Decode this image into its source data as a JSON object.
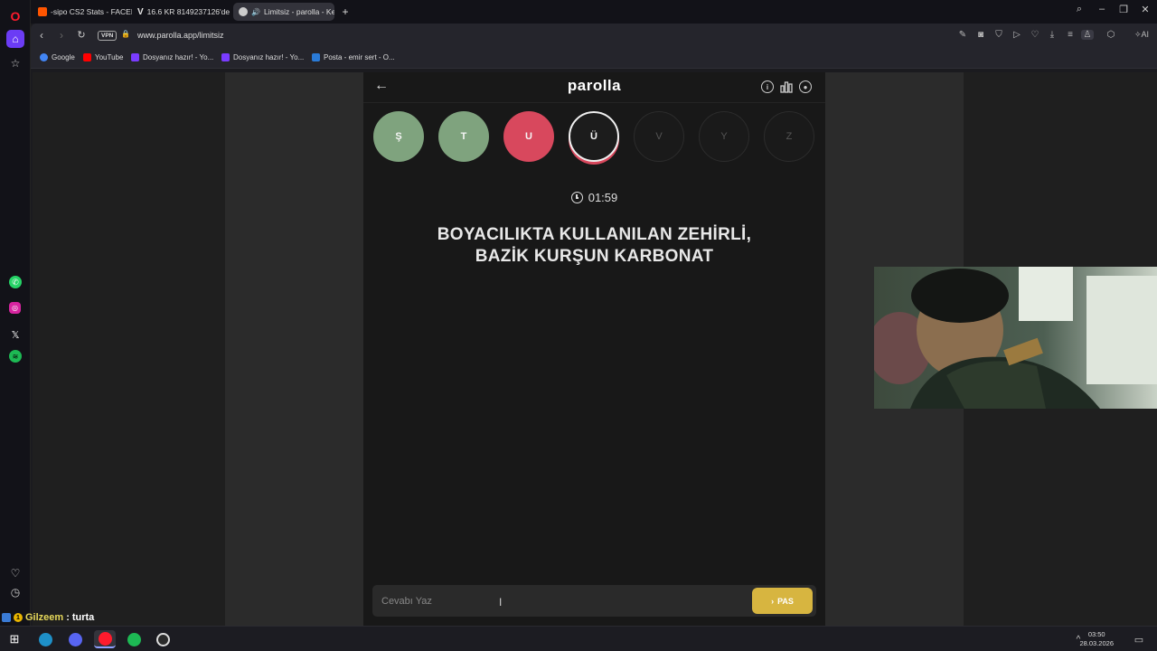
{
  "browser": {
    "tabs": [
      {
        "title": "-sipo CS2 Stats - FACEIT.c",
        "active": false,
        "color": "#ff5500"
      },
      {
        "title": "16.6 KR 8149237126'de Fı",
        "active": false,
        "color": "#e8e8e8"
      },
      {
        "title": "Limitsiz - parolla - Ke",
        "active": true,
        "color": "#cccccc"
      }
    ],
    "vpn_label": "VPN",
    "url": "www.parolla.app/limitsiz",
    "ai_label": "AI",
    "bookmarks": [
      {
        "label": "Google",
        "color": "#4285f4"
      },
      {
        "label": "YouTube",
        "color": "#ff0000"
      },
      {
        "label": "Dosyanız hazır! - Yo...",
        "color": "#7a3cff"
      },
      {
        "label": "Dosyanız hazır! - Yo...",
        "color": "#7a3cff"
      },
      {
        "label": "Posta - emir sert - O...",
        "color": "#2a7bd8"
      }
    ]
  },
  "game": {
    "brand": "parolla",
    "letters": [
      {
        "char": "Ş",
        "state": "correct"
      },
      {
        "char": "T",
        "state": "correct"
      },
      {
        "char": "U",
        "state": "wrong"
      },
      {
        "char": "Ü",
        "state": "current"
      },
      {
        "char": "V",
        "state": "pending"
      },
      {
        "char": "Y",
        "state": "pending"
      },
      {
        "char": "Z",
        "state": "pending"
      }
    ],
    "timer": "01:59",
    "question_line1": "BOYACILIKTA KULLANILAN ZEHİRLİ,",
    "question_line2": "BAZİK KURŞUN KARBONAT",
    "answer_placeholder": "Cevabı Yaz",
    "pass_label": "PAS"
  },
  "chat": {
    "badge": "1",
    "user": "Gilzeem",
    "separator": ":",
    "message": "turta"
  },
  "taskbar": {
    "time": "03:50",
    "date": "28.03.2026"
  }
}
